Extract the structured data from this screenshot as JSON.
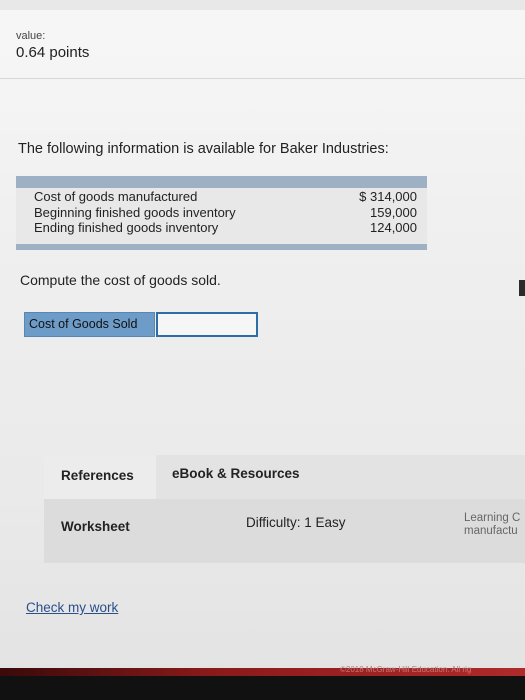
{
  "header": {
    "value_label": "value:",
    "points": "0.64 points"
  },
  "question": {
    "text": "The following information is available for Baker Industries:"
  },
  "info_table": {
    "rows": [
      {
        "label": "Cost of goods manufactured",
        "value": "$ 314,000"
      },
      {
        "label": "Beginning finished goods inventory",
        "value": "159,000"
      },
      {
        "label": "Ending finished goods inventory",
        "value": "124,000"
      }
    ]
  },
  "prompt": {
    "text": "Compute the cost of goods sold."
  },
  "answer": {
    "label": "Cost of Goods Sold",
    "value": ""
  },
  "references": {
    "tab_references": "References",
    "tab_ebook": "eBook & Resources",
    "worksheet": "Worksheet",
    "difficulty": "Difficulty: 1 Easy",
    "learning_line1": "Learning C",
    "learning_line2": "manufactu"
  },
  "actions": {
    "check_my_work": "Check my work"
  },
  "footer": {
    "copyright": "©2018 McGraw-Hill Education. All rig"
  },
  "colors": {
    "table_bar": "#9db0c4",
    "answer_label_bg": "#6d9cc9",
    "answer_input_border": "#2e6ea6",
    "link": "#2b4f8a"
  }
}
